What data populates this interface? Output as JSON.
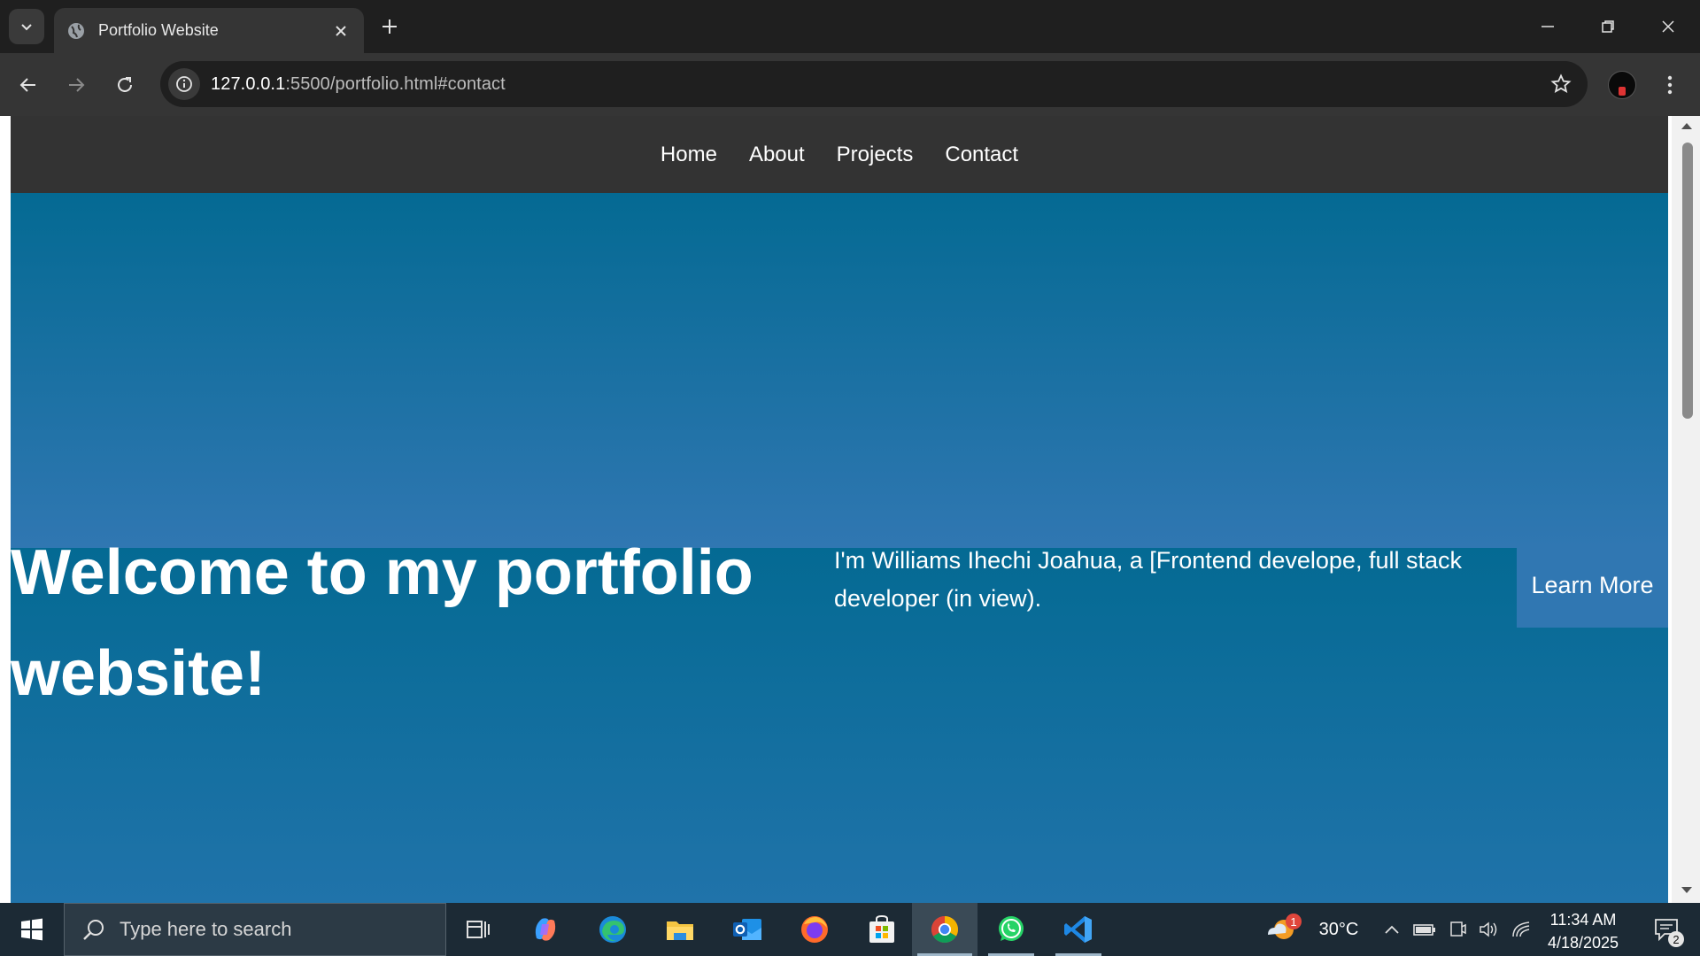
{
  "browser": {
    "tab": {
      "title": "Portfolio Website"
    },
    "url": {
      "host": "127.0.0.1",
      "path": ":5500/portfolio.html#contact"
    }
  },
  "site": {
    "nav": [
      "Home",
      "About",
      "Projects",
      "Contact"
    ],
    "hero": {
      "title": "Welcome to my portfolio website!",
      "text": "I'm Williams Ihechi Joahua, a [Frontend develope, full stack developer (in view).",
      "button": "Learn More"
    },
    "colors": {
      "nav_bg": "#333333",
      "hero_dark": "#046a93",
      "hero_light": "#3077b2"
    }
  },
  "taskbar": {
    "search_placeholder": "Type here to search",
    "apps": [
      "task-view",
      "copilot",
      "edge",
      "file-explorer",
      "outlook",
      "firefox",
      "microsoft-store",
      "chrome",
      "whatsapp",
      "vscode"
    ],
    "weather": {
      "temp": "30°C",
      "badge": "1"
    },
    "clock": {
      "time": "11:34 AM",
      "date": "4/18/2025"
    },
    "notifications": "2"
  }
}
